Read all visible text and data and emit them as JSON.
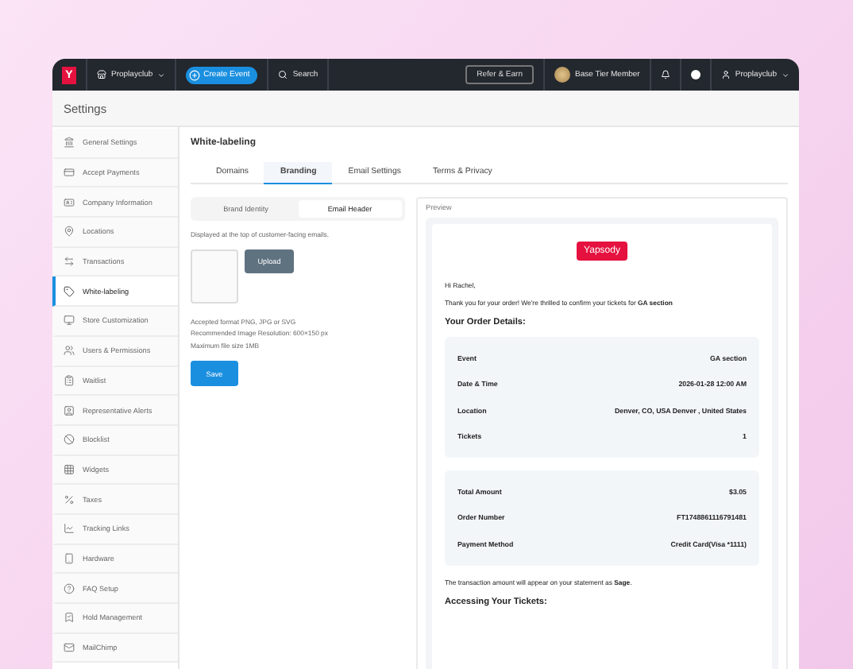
{
  "topbar": {
    "logo": "Y",
    "org": "Proplayclub",
    "create_button": "Create Event",
    "search": "Search",
    "refer_button": "Refer & Earn",
    "tier": "Base Tier Member",
    "user": "Proplayclub"
  },
  "header": {
    "title": "Settings"
  },
  "sidebar": {
    "items": [
      {
        "label": "General Settings",
        "selected": false
      },
      {
        "label": "Accept Payments",
        "selected": false
      },
      {
        "label": "Company Information",
        "selected": false
      },
      {
        "label": "Locations",
        "selected": false
      },
      {
        "label": "Transactions",
        "selected": false
      },
      {
        "label": "White-labeling",
        "selected": true
      },
      {
        "label": "Store Customization",
        "selected": false
      },
      {
        "label": "Users & Permissions",
        "selected": false
      },
      {
        "label": "Waitlist",
        "selected": false
      },
      {
        "label": "Representative Alerts",
        "selected": false
      },
      {
        "label": "Blocklist",
        "selected": false
      },
      {
        "label": "Widgets",
        "selected": false
      },
      {
        "label": "Taxes",
        "selected": false
      },
      {
        "label": "Tracking Links",
        "selected": false
      },
      {
        "label": "Hardware",
        "selected": false
      },
      {
        "label": "FAQ Setup",
        "selected": false
      },
      {
        "label": "Hold Management",
        "selected": false
      },
      {
        "label": "MailChimp",
        "selected": false
      }
    ]
  },
  "content": {
    "title": "White-labeling",
    "tabs": [
      {
        "label": "Domains",
        "selected": false
      },
      {
        "label": "Branding",
        "selected": true
      },
      {
        "label": "Email Settings",
        "selected": false
      },
      {
        "label": "Terms & Privacy",
        "selected": false
      }
    ],
    "subtabs": [
      {
        "label": "Brand Identity",
        "selected": false
      },
      {
        "label": "Email Header",
        "selected": true
      }
    ],
    "description": "Displayed at the top of customer-facing emails.",
    "upload_button": "Upload",
    "notes": [
      "Accepted format PNG, JPG or SVG",
      "Recommended Image Resolution: 600×150 px",
      "Maximum file size 1MB"
    ],
    "save_button": "Save"
  },
  "preview": {
    "label": "Preview",
    "brand": "Yapsody",
    "greeting": "Hi Rachel,",
    "intro": "Thank you for your order! We're thrilled to confirm your tickets for **GA section**",
    "details_heading": "Your Order Details:",
    "order_rows": [
      {
        "label": "Event",
        "value": "GA section"
      },
      {
        "label": "Date & Time",
        "value": "2026-01-28 12:00 AM"
      },
      {
        "label": "Location",
        "value": "Denver, CO, USA Denver , United States"
      },
      {
        "label": "Tickets",
        "value": "1"
      }
    ],
    "payment_rows": [
      {
        "label": "Total Amount",
        "value": "$3.05"
      },
      {
        "label": "Order Number",
        "value": "FT1748861116791481"
      },
      {
        "label": "Payment Method",
        "value": "Credit Card(Visa *1111)"
      }
    ],
    "statement": "The transaction amount will appear on your statement as **Sage**.",
    "access_heading": "Accessing Your Tickets:"
  }
}
